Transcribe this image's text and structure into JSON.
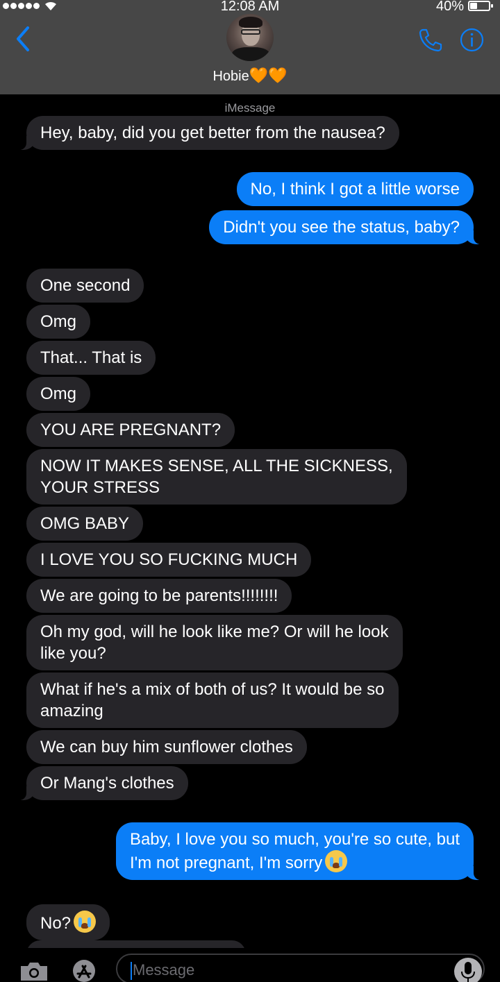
{
  "status_bar": {
    "time": "12:08 AM",
    "battery_percent_text": "40%",
    "battery_level": 0.4,
    "signal_bars": 5,
    "icons": [
      "signal-dots-icon",
      "wifi-icon",
      "battery-icon"
    ]
  },
  "header": {
    "contact_name": "Hobie",
    "contact_hearts": "🧡🧡",
    "icons": [
      "back-chevron-icon",
      "contact-avatar",
      "phone-icon",
      "info-icon"
    ],
    "accent_color": "#0b7ef7"
  },
  "conversation": {
    "service_label": "iMessage",
    "messages": [
      {
        "from": "them",
        "text": "Hey, baby, did you get better from the nausea?"
      },
      {
        "from": "me",
        "text": "No, I think I got a little worse"
      },
      {
        "from": "me",
        "text": "Didn't you see the status, baby?"
      },
      {
        "from": "them",
        "text": "One second"
      },
      {
        "from": "them",
        "text": "Omg"
      },
      {
        "from": "them",
        "text": "That... That is"
      },
      {
        "from": "them",
        "text": "Omg"
      },
      {
        "from": "them",
        "text": "YOU ARE PREGNANT?"
      },
      {
        "from": "them",
        "text_line1": "NOW IT MAKES SENSE, ALL THE SICKNESS,",
        "text_line2": "YOUR STRESS"
      },
      {
        "from": "them",
        "text": "OMG BABY"
      },
      {
        "from": "them",
        "text": "I LOVE YOU SO FUCKING MUCH"
      },
      {
        "from": "them",
        "text": "We are going to be parents!!!!!!!!"
      },
      {
        "from": "them",
        "text_line1": "Oh my god, will he look like me? Or will he look",
        "text_line2": "like you?"
      },
      {
        "from": "them",
        "text_line1": "What if he's a mix of both of us? It would be so",
        "text_line2": "amazing"
      },
      {
        "from": "them",
        "text": "We can buy him sunflower clothes"
      },
      {
        "from": "them",
        "text": "Or Mang's clothes"
      },
      {
        "from": "me",
        "text_line1": "Baby, I love you so much, you're so cute, but",
        "text_line2": "I'm not pregnant, I'm sorry",
        "emoji": "crying-face-icon"
      },
      {
        "from": "them",
        "text": "No?",
        "emoji": "crying-face-icon"
      }
    ],
    "bubble_colors": {
      "incoming": "#262529",
      "outgoing": "#0b7ef7"
    }
  },
  "input_bar": {
    "placeholder": "Message",
    "icons": [
      "camera-icon",
      "app-store-icon",
      "microphone-icon"
    ]
  }
}
